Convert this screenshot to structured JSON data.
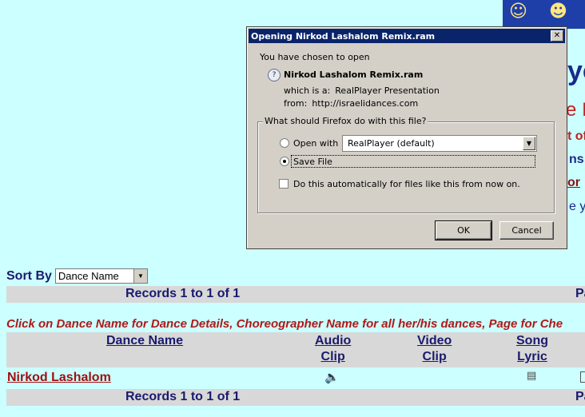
{
  "background_page": {
    "fragments": {
      "big_blue": "yo",
      "red1": "e Is",
      "red2": "t of",
      "blue1": "ns",
      "red_link": "or",
      "blue2": "e yo"
    },
    "sort": {
      "label": "Sort By",
      "selected": "Dance Name"
    },
    "records_text": "Records 1 to 1 of 1",
    "page_fragment": "Pa",
    "instruction": "Click on Dance Name for Dance Details, Choreographer Name for all her/his dances, Page for Che",
    "columns": {
      "dance_name": "Dance Name",
      "audio_1": "Audio",
      "audio_2": "Clip",
      "video_1": "Video",
      "video_2": "Clip",
      "song_1": "Song",
      "song_2": "Lyric"
    },
    "rows": [
      {
        "dance_name": "Nirkod Lashalom",
        "audio_icon": "speaker-icon",
        "lyric_icon": "document-icon"
      }
    ]
  },
  "dialog": {
    "title": "Opening Nirkod Lashalom Remix.ram",
    "close_glyph": "✕",
    "chosen_text": "You have chosen to open",
    "file_name": "Nirkod Lashalom Remix.ram",
    "which_label": "which is a:",
    "which_value": "RealPlayer Presentation",
    "from_label": "from:",
    "from_value": "http://israelidances.com",
    "group_title": "What should Firefox do with this file?",
    "open_with_label": "Open with",
    "open_with_app": "RealPlayer (default)",
    "save_file_label": "Save File",
    "selected_option": "save_file",
    "auto_label": "Do this automatically for files like this from now on.",
    "auto_checked": false,
    "ok_label": "OK",
    "cancel_label": "Cancel"
  },
  "colors": {
    "page_bg": "#ccffff",
    "titlebar": "#0a246a",
    "dialog_bg": "#d4d0c8",
    "link_red": "#a01010",
    "heading_blue": "#1a1a6e"
  }
}
